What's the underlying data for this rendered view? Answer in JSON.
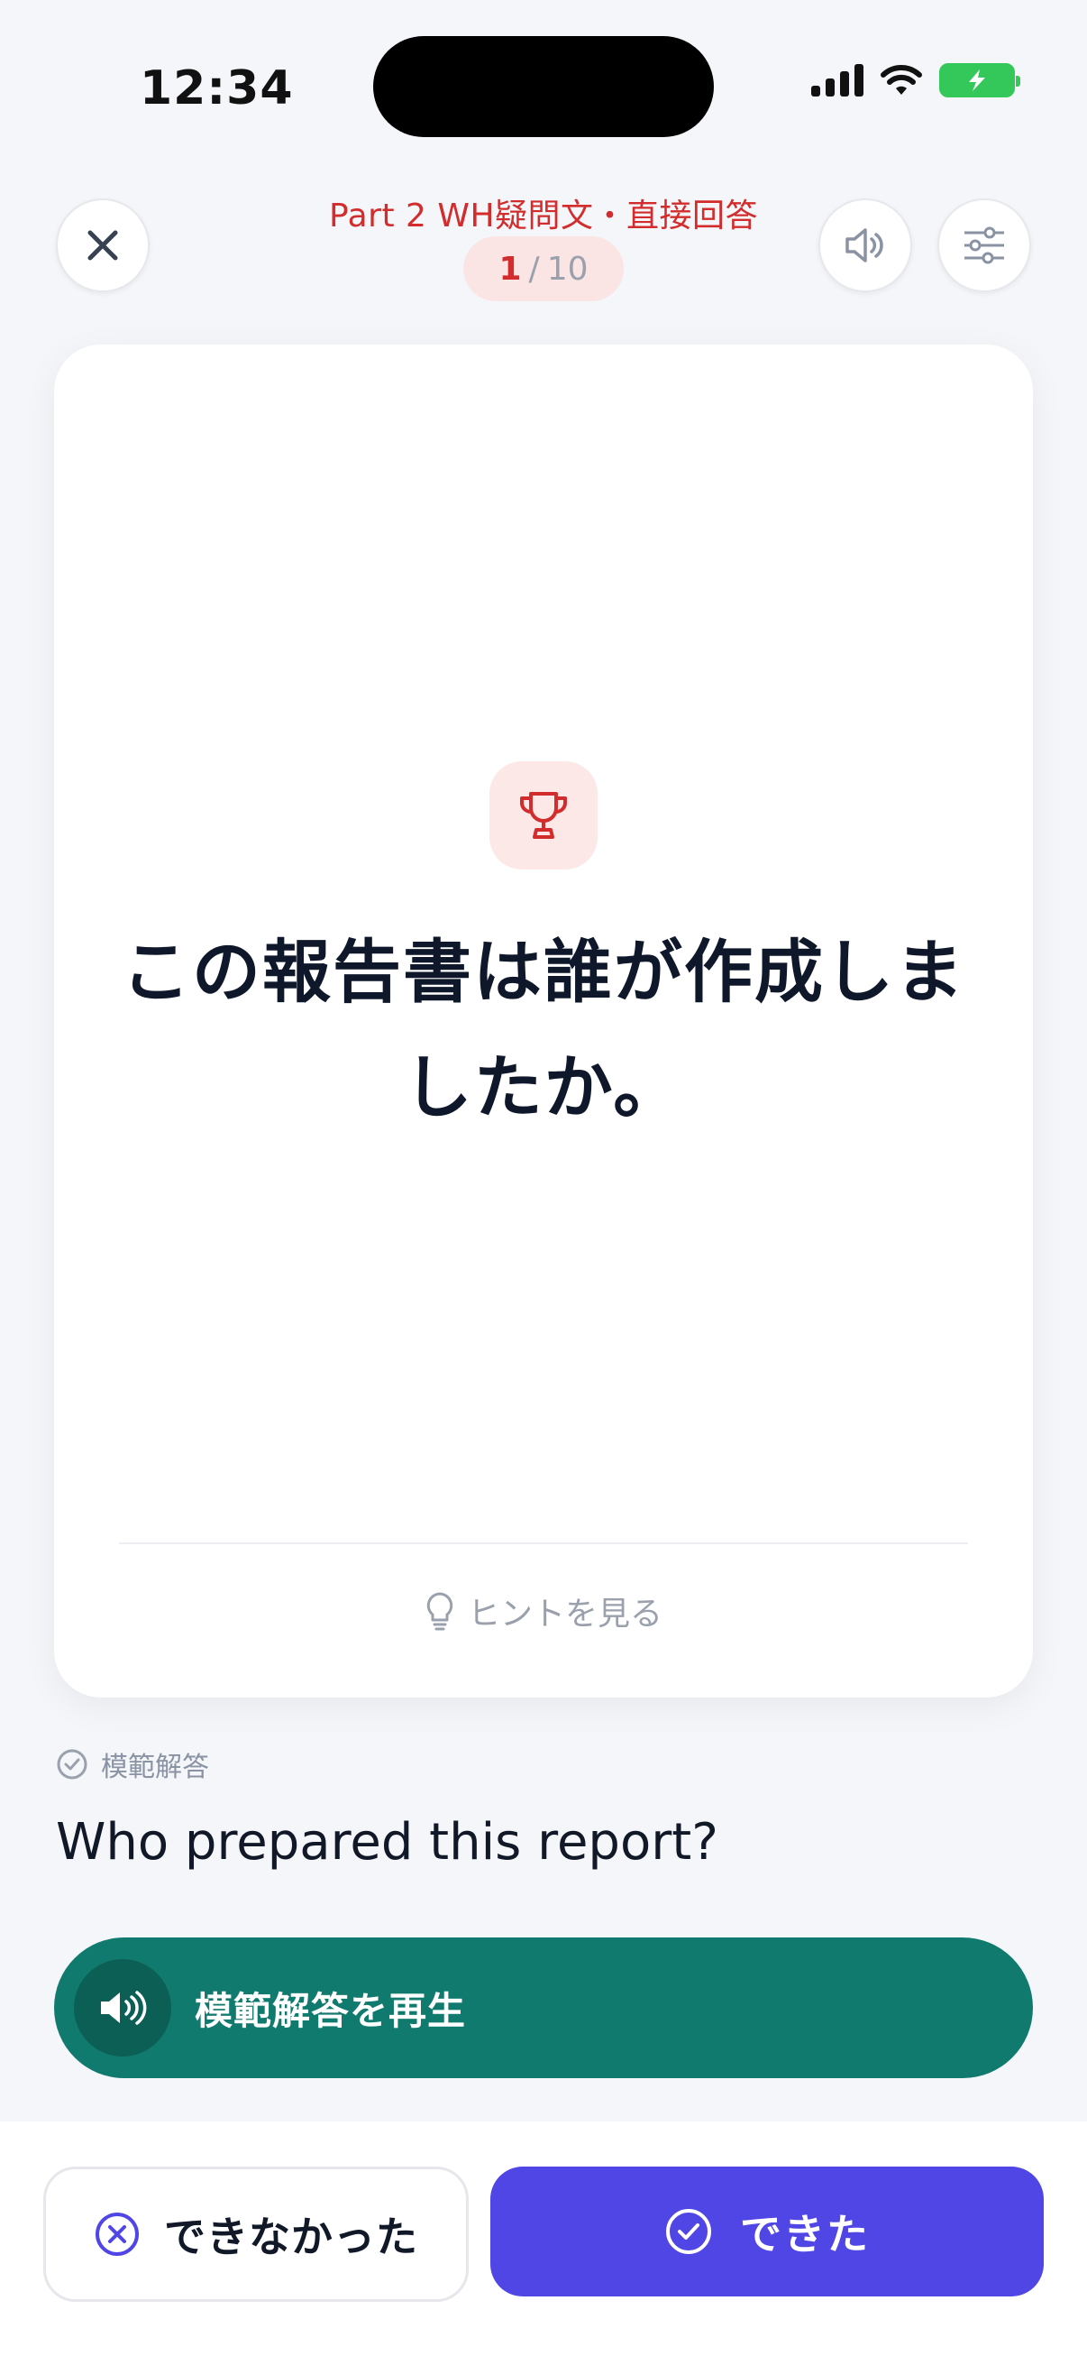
{
  "status_bar": {
    "time": "12:34"
  },
  "header": {
    "title": "Part 2 WH疑問文・直接回答",
    "progress_current": "1",
    "progress_separator": "/",
    "progress_total": "10"
  },
  "card": {
    "question": "この報告書は誰が作成しましたか。",
    "hint_label": "ヒントを見る"
  },
  "model_answer": {
    "label": "模範解答",
    "text": "Who prepared this report?",
    "play_label": "模範解答を再生"
  },
  "actions": {
    "fail_label": "できなかった",
    "ok_label": "できた"
  },
  "colors": {
    "accent_red": "#d22c2c",
    "teal": "#117a6e",
    "indigo": "#5046e5"
  }
}
